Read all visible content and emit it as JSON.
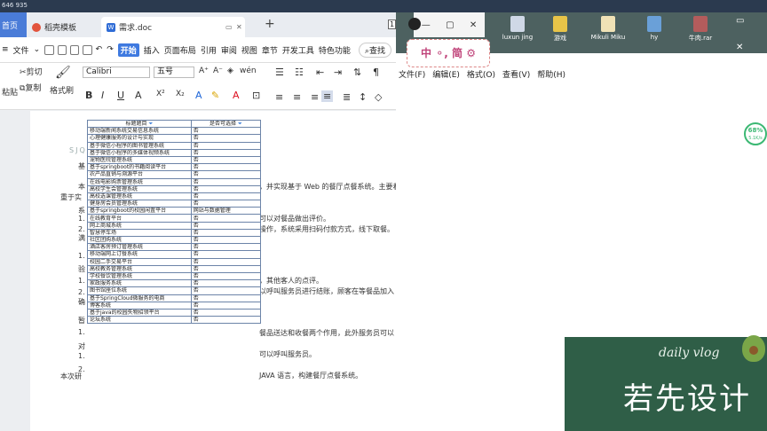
{
  "topbar": {
    "text": "646 935"
  },
  "wps": {
    "tabs": {
      "home": "首页",
      "templates": "稻壳模板",
      "doc": "需求.doc"
    },
    "menu": {
      "file": "文件",
      "items": [
        "开始",
        "插入",
        "页面布局",
        "引用",
        "审阅",
        "视图",
        "章节",
        "开发工具",
        "特色功能"
      ],
      "search": "查找"
    },
    "ribbon": {
      "cut": "剪切",
      "paste": "粘贴",
      "copy": "复制",
      "format_painter": "格式刷",
      "font": "Calibri",
      "size": "五号",
      "fmt_buttons": [
        "B",
        "I",
        "U",
        "A",
        "X²",
        "X₂"
      ]
    },
    "document": {
      "left_snippets": [
        "SJQU",
        "基",
        "本",
        "重于实",
        "系",
        "1.",
        "2.",
        "满",
        "1.",
        "验",
        "1.",
        "2.",
        "确",
        "暂",
        "1.",
        "对",
        "1.",
        "2.",
        "本次研"
      ],
      "right_snippets": [
        "，并实现基于 Web 的餐厅点餐系统。主要着",
        "可以对餐品做出评价。",
        "操作，系统采用扫码付款方式，线下取餐。",
        "，其他客人的点评。",
        "以呼叫服务员进行结账，顾客在等餐品加入",
        "餐品送达和收餐两个作用，此外服务员可以",
        "可以呼叫服务员。",
        "JAVA 语言，构建餐厅点餐系统。"
      ]
    },
    "table": {
      "headers": [
        "标题题目",
        "是否可选择"
      ],
      "rows": [
        [
          "移动端新闻系统交易信息系统",
          "否"
        ],
        [
          "心理健康服务的设计与实现",
          "否"
        ],
        [
          "基于微信小程序的图书管理系统",
          "否"
        ],
        [
          "基于微信小程序的多媒体视频系统",
          "否"
        ],
        [
          "宠物医院管理系统",
          "否"
        ],
        [
          "基于springboot的书籍阅读平台",
          "否"
        ],
        [
          "农产品直销与溯源平台",
          "否"
        ],
        [
          "在线电影购票管理系统",
          "否"
        ],
        [
          "高校学生会管理系统",
          "否"
        ],
        [
          "高校选课管理系统",
          "否"
        ],
        [
          "健身房会员管理系统",
          "否"
        ],
        [
          "基于springboot的校园闲置平台",
          "网站与数据管理"
        ],
        [
          "在线教育平台",
          "否"
        ],
        [
          "网上商城系统",
          "否"
        ],
        [
          "智慧停车场",
          "否"
        ],
        [
          "社区团购系统",
          "否"
        ],
        [
          "酒店客房预订管理系统",
          "否"
        ],
        [
          "移动端网上订餐系统",
          "否"
        ],
        [
          "校园二手交易平台",
          "否"
        ],
        [
          "高校教务管理系统",
          "否"
        ],
        [
          "学校餐饮管理系统",
          "否"
        ],
        [
          "家政服务系统",
          "否"
        ],
        [
          "图书馆座位系统",
          "否"
        ],
        [
          "基于SpringCloud微服务的电商",
          "否"
        ],
        [
          "博客系统",
          "否"
        ],
        [
          "基于java的校园失物招领平台",
          "否"
        ],
        [
          "论坛系统",
          "否"
        ]
      ]
    }
  },
  "notepad": {
    "menu": [
      "文件(F)",
      "编辑(E)",
      "格式(O)",
      "查看(V)",
      "帮助(H)"
    ]
  },
  "desktop": {
    "icons": [
      "luxun jing",
      "游戏",
      "Mikuli Miku",
      "hy",
      "牛肉.rar"
    ]
  },
  "sticker": {
    "text": "中 ⚬, 简 ⚙"
  },
  "badge": {
    "percent": "68%",
    "sub": "5.1K/s"
  },
  "watermark": {
    "small": "daily vlog",
    "big": "若先设计"
  }
}
